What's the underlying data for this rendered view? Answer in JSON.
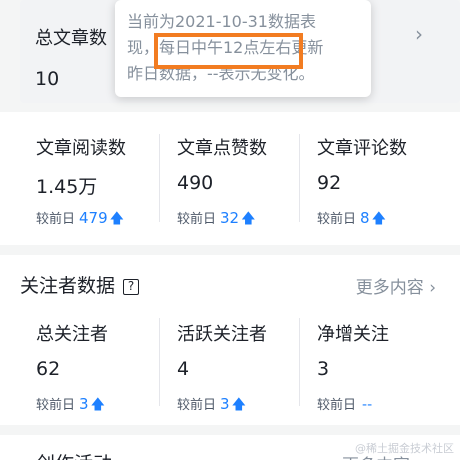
{
  "top": {
    "label_left": "总文章数",
    "value_left": "10",
    "label_right_partial": "数",
    "chevron": "›"
  },
  "tooltip": {
    "line1": "当前为2021-10-31数据表",
    "line2": "现，每日中午12点左右更新",
    "line3": "昨日数据，--表示无变化。"
  },
  "articles": {
    "items": [
      {
        "label": "文章阅读数",
        "value": "1.45万",
        "cmp_label": "较前日",
        "cmp_value": "479",
        "trend": "up-arrow"
      },
      {
        "label": "文章点赞数",
        "value": "490",
        "cmp_label": "较前日",
        "cmp_value": "32",
        "trend": "up-arrow"
      },
      {
        "label": "文章评论数",
        "value": "92",
        "cmp_label": "较前日",
        "cmp_value": "8",
        "trend": "up-arrow"
      }
    ]
  },
  "followers": {
    "title": "关注者数据",
    "help": "?",
    "more": "更多内容 ›",
    "items": [
      {
        "label": "总关注者",
        "value": "62",
        "cmp_label": "较前日",
        "cmp_value": "3",
        "trend": "up-arrow"
      },
      {
        "label": "活跃关注者",
        "value": "4",
        "cmp_label": "较前日",
        "cmp_value": "3",
        "trend": "up-arrow"
      },
      {
        "label": "净增关注",
        "value": "3",
        "cmp_label": "较前日",
        "cmp_value": "--",
        "trend": "none"
      }
    ]
  },
  "creation": {
    "title_partial": "创作活动",
    "more_partial": "更多内容"
  },
  "watermark": "@稀土掘金技术社区",
  "colors": {
    "accent": "#1e80ff",
    "highlight": "#f27c21"
  }
}
